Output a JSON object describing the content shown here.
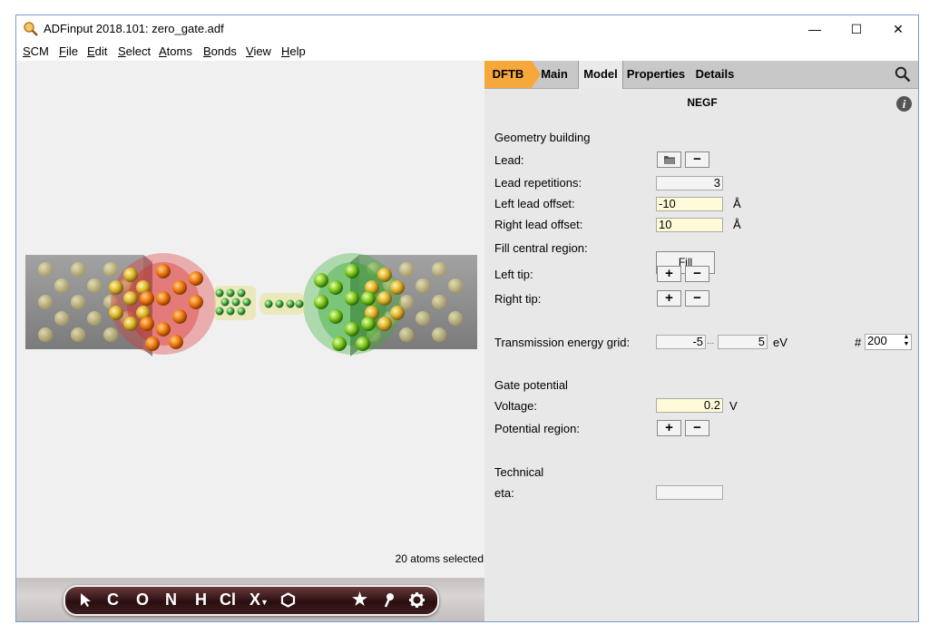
{
  "window": {
    "title": "ADFinput 2018.101: zero_gate.adf",
    "minimize": "—",
    "maximize": "☐",
    "close": "✕"
  },
  "menu": [
    {
      "key": "S",
      "rest": "CM"
    },
    {
      "key": "F",
      "rest": "ile"
    },
    {
      "key": "E",
      "rest": "dit"
    },
    {
      "key": "S",
      "rest": "elect"
    },
    {
      "key": "A",
      "rest": "toms"
    },
    {
      "key": "B",
      "rest": "onds"
    },
    {
      "key": "V",
      "rest": "iew"
    },
    {
      "key": "H",
      "rest": "elp"
    }
  ],
  "viewport": {
    "status": "20 atoms selected"
  },
  "toolbar": {
    "c": "C",
    "o": "O",
    "n": "N",
    "h": "H",
    "cl": "Cl",
    "x": "X"
  },
  "tabs": {
    "dftb": "DFTB",
    "main": "Main",
    "model": "Model",
    "properties": "Properties",
    "details": "Details"
  },
  "panel": {
    "section_title": "NEGF",
    "info": "i",
    "geometry_heading": "Geometry building",
    "lead_label": "Lead:",
    "lead_repetitions_label": "Lead repetitions:",
    "lead_repetitions_value": "3",
    "left_offset_label": "Left lead offset:",
    "left_offset_value": "-10",
    "left_offset_unit": "Å",
    "right_offset_label": "Right lead offset:",
    "right_offset_value": "10",
    "right_offset_unit": "Å",
    "fill_label": "Fill central region:",
    "fill_button": "Fill",
    "left_tip_label": "Left tip:",
    "right_tip_label": "Right tip:",
    "transmission_label": "Transmission energy grid:",
    "transmission_min": "-5",
    "transmission_dots": "...",
    "transmission_max": "5",
    "transmission_unit": "eV",
    "count_symbol": "#",
    "count_value": "200",
    "gate_heading": "Gate potential",
    "voltage_label": "Voltage:",
    "voltage_value": "0.2",
    "voltage_unit": "V",
    "potential_region_label": "Potential region:",
    "technical_heading": "Technical",
    "eta_label": "eta:",
    "eta_value": "",
    "plus": "+",
    "minus": "−"
  }
}
